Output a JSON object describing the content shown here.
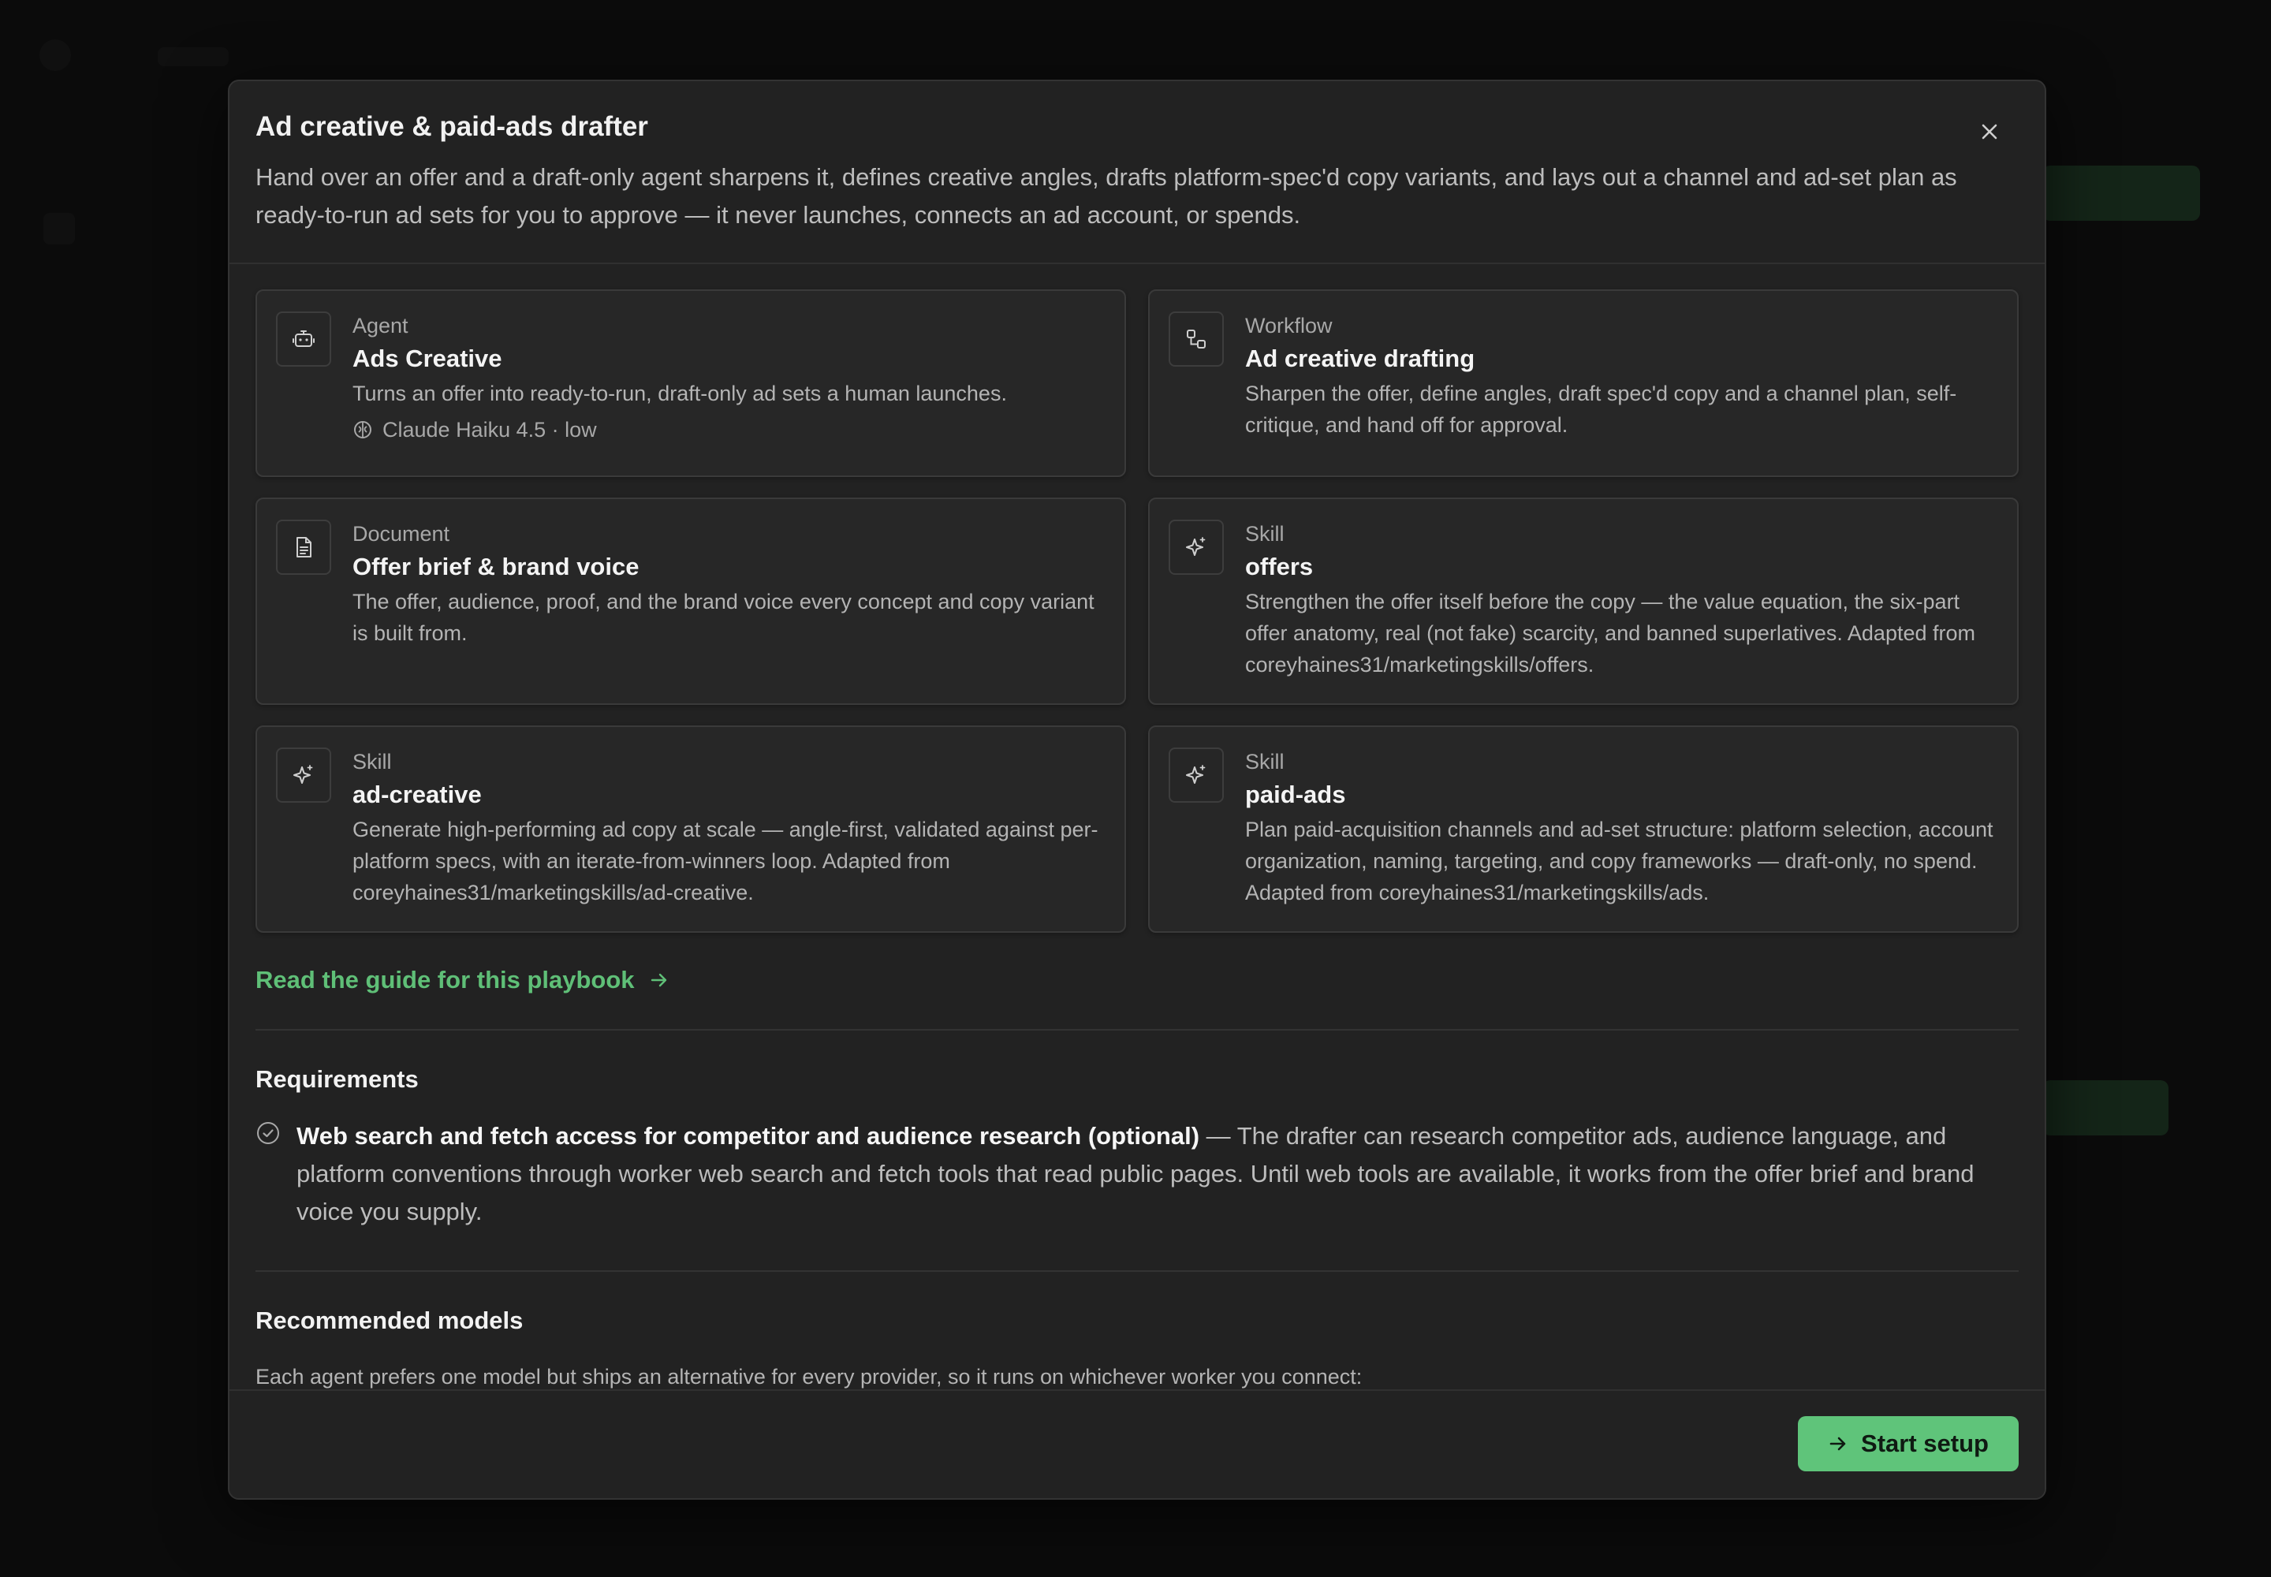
{
  "modal": {
    "title": "Ad creative & paid-ads drafter",
    "description": "Hand over an offer and a draft-only agent sharpens it, defines creative angles, drafts platform-spec'd copy variants, and lays out a channel and ad-set plan as ready-to-run ad sets for you to approve — it never launches, connects an ad account, or spends.",
    "close_icon": "close-icon"
  },
  "cards": [
    {
      "kind": "Agent",
      "title": "Ads Creative",
      "description": "Turns an offer into ready-to-run, draft-only ad sets a human launches.",
      "meta": "Claude Haiku 4.5 · low",
      "icon": "bot-icon"
    },
    {
      "kind": "Workflow",
      "title": "Ad creative drafting",
      "description": "Sharpen the offer, define angles, draft spec'd copy and a channel plan, self-critique, and hand off for approval.",
      "icon": "workflow-icon"
    },
    {
      "kind": "Document",
      "title": "Offer brief & brand voice",
      "description": "The offer, audience, proof, and the brand voice every concept and copy variant is built from.",
      "icon": "document-icon"
    },
    {
      "kind": "Skill",
      "title": "offers",
      "description": "Strengthen the offer itself before the copy — the value equation, the six-part offer anatomy, real (not fake) scarcity, and banned superlatives. Adapted from coreyhaines31/marketingskills/offers.",
      "icon": "sparkles-icon"
    },
    {
      "kind": "Skill",
      "title": "ad-creative",
      "description": "Generate high-performing ad copy at scale — angle-first, validated against per-platform specs, with an iterate-from-winners loop. Adapted from coreyhaines31/marketingskills/ad-creative.",
      "icon": "sparkles-icon"
    },
    {
      "kind": "Skill",
      "title": "paid-ads",
      "description": "Plan paid-acquisition channels and ad-set structure: platform selection, account organization, naming, targeting, and copy frameworks — draft-only, no spend. Adapted from coreyhaines31/marketingskills/ads.",
      "icon": "sparkles-icon"
    }
  ],
  "guide_link": "Read the guide for this playbook",
  "requirements": {
    "title": "Requirements",
    "item_title": "Web search and fetch access for competitor and audience research (optional)",
    "item_text": " — The drafter can research competitor ads, audience language, and platform conventions through worker web search and fetch tools that read public pages. Until web tools are available, it works from the offer brief and brand voice you supply."
  },
  "models": {
    "title": "Recommended models",
    "description": "Each agent prefers one model but ships an alternative for every provider, so it runs on whichever worker you connect:"
  },
  "footer": {
    "start_label": "Start setup"
  },
  "colors": {
    "accent": "#5fc47a",
    "link": "#5fbf77",
    "modal_bg": "#222222"
  }
}
